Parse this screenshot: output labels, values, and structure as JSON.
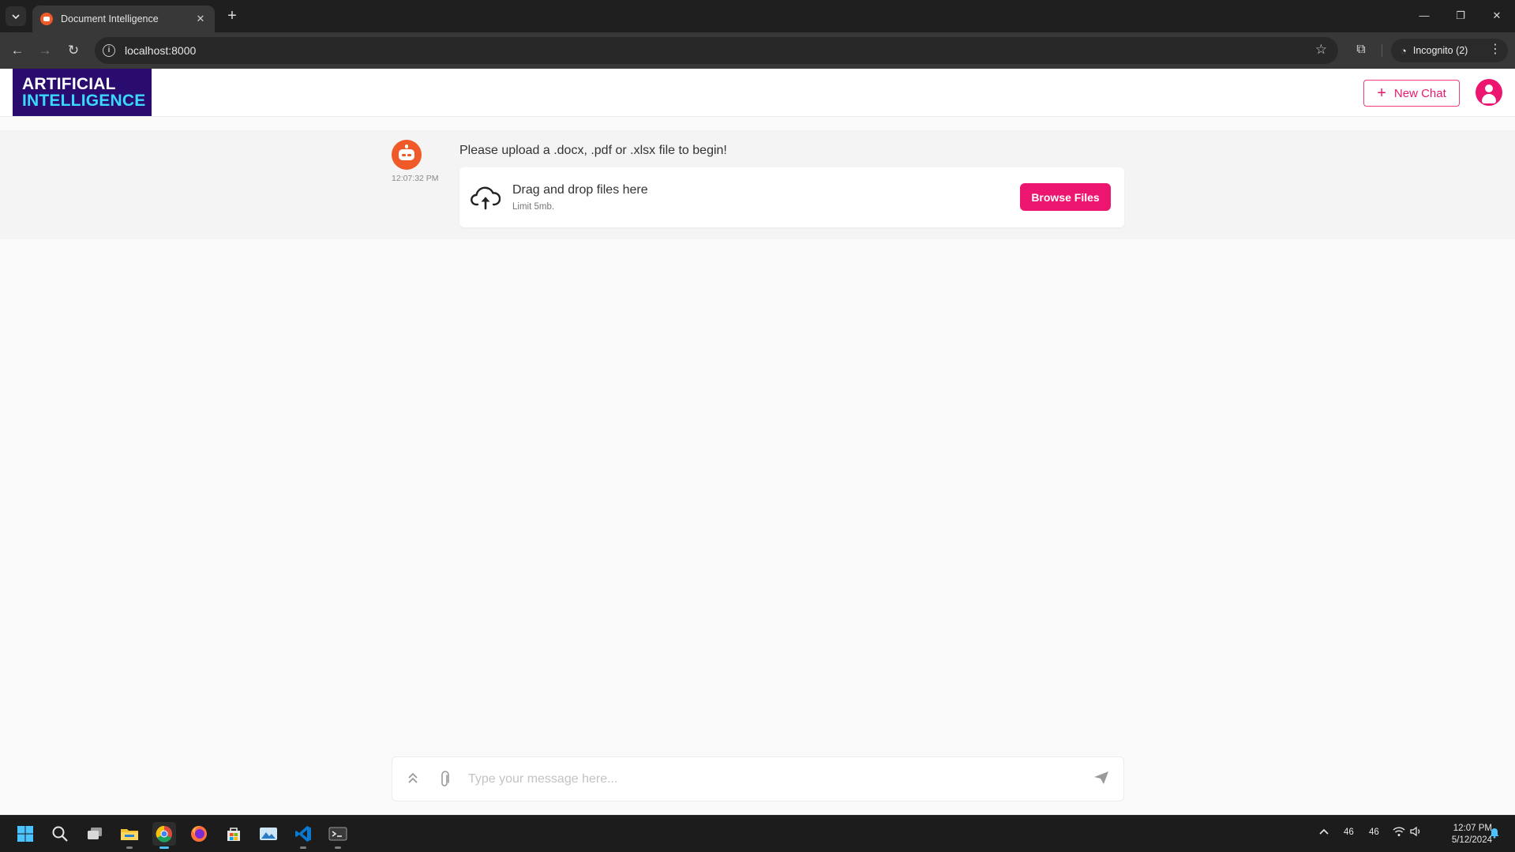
{
  "browser": {
    "tab_title": "Document Intelligence",
    "url": "localhost:8000",
    "incognito_label": "Incognito (2)"
  },
  "app": {
    "logo_line1": "ARTIFICIAL",
    "logo_line2": "INTELLIGENCE",
    "new_chat_label": "New Chat",
    "colors": {
      "accent": "#ec1670",
      "bot": "#f05a28",
      "logo_bg": "#2a0b6e",
      "logo_highlight": "#3ad7ff"
    }
  },
  "chat": {
    "messages": [
      {
        "sender": "bot",
        "time": "12:07:32 PM",
        "text": "Please upload a .docx, .pdf or .xlsx file to begin!"
      }
    ],
    "upload": {
      "title": "Drag and drop files here",
      "limit": "Limit 5mb.",
      "button": "Browse Files"
    }
  },
  "composer": {
    "placeholder": "Type your message here..."
  },
  "taskbar": {
    "tray_value_1": "46",
    "tray_value_2": "46",
    "time": "12:07 PM",
    "date": "5/12/2024"
  }
}
